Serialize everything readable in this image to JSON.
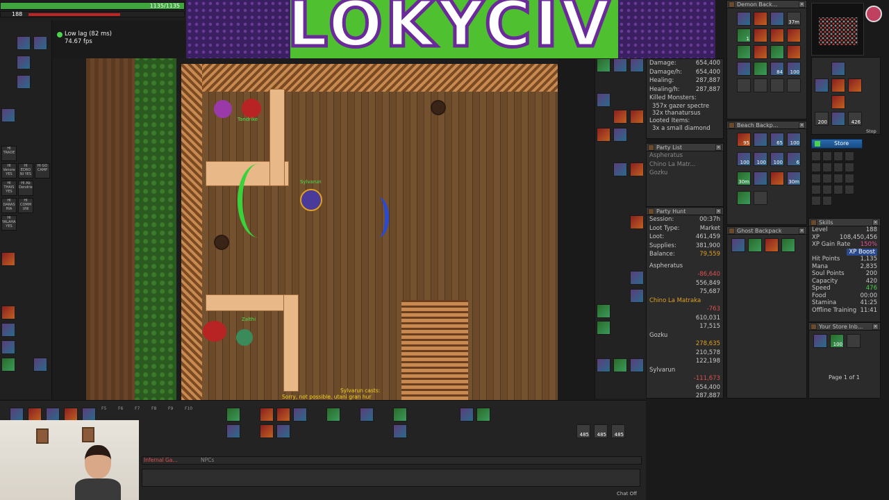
{
  "status": {
    "health_text": "1135/1135",
    "health_fraction": 1.0,
    "mana_value": "188",
    "mana_fraction": 0.5,
    "health_color": "#3fa63f",
    "mana_color": "#c02424"
  },
  "lag": {
    "label": "Low lag (82 ms)",
    "fps": "74.67 fps"
  },
  "stream_banner": {
    "text": "LOKYCIV",
    "bg_color": "#4fc030"
  },
  "map": {
    "char_names": [
      "Tandrike",
      "Sylvarun",
      "Zalthi"
    ],
    "cast_line1": "Sylvarun casts:",
    "cast_line2": "Sorry, not possible. utani gran hur"
  },
  "left_buttons": [
    "HI TRADE",
    "HI Venore YES",
    "HI EDRO NI YES",
    "HI GO CAMP",
    "HI THAIS YES",
    "HI Ab Dendriel",
    "HI DARAS HIA",
    "HI COMM UNI",
    "HI YALAHAR YES"
  ],
  "analytics": {
    "rows": [
      {
        "label": "Damage:",
        "value": "654,400"
      },
      {
        "label": "Damage/h:",
        "value": "654,400"
      },
      {
        "label": "Healing:",
        "value": "287,887"
      },
      {
        "label": "Healing/h:",
        "value": "287,887"
      }
    ],
    "killed_label": "Killed Monsters:",
    "killed": [
      "357x gazer spectre",
      "32x thanatursus"
    ],
    "looted_label": "Looted Items:",
    "looted": [
      "3x a small diamond"
    ]
  },
  "party_list": {
    "title": "Party List",
    "members": [
      "Aspheratus",
      "Chino La Matr...",
      "Gozku"
    ]
  },
  "party_hunt": {
    "title": "Party Hunt",
    "summary": [
      {
        "label": "Session:",
        "value": "00:37h"
      },
      {
        "label": "Loot Type:",
        "value": "Market"
      },
      {
        "label": "Loot:",
        "value": "461,459"
      },
      {
        "label": "Supplies:",
        "value": "381,900"
      },
      {
        "label": "Balance:",
        "value": "79,559"
      }
    ],
    "players": [
      {
        "name": "Aspheratus",
        "balance": "-86,640",
        "damage": "556,849",
        "healing": "75,687"
      },
      {
        "name": "Chino La Matraka",
        "balance": "-763",
        "damage": "610,031",
        "healing": "17,515"
      },
      {
        "name": "Gozku",
        "balance": "278,635",
        "damage": "210,578",
        "healing": "122,198"
      },
      {
        "name": "Sylvarun",
        "balance": "-111,673",
        "damage": "654,400",
        "healing": "287,887"
      }
    ]
  },
  "demon_backpack": {
    "title": "Demon Back...",
    "counts": [
      "37m",
      "1",
      "84",
      "100"
    ]
  },
  "beach_backpack": {
    "title": "Beach Backp...",
    "counts": [
      "95",
      "65",
      "100",
      "100",
      "100",
      "100",
      "6",
      "30m",
      "30m"
    ]
  },
  "ghost_backpack": {
    "title": "Ghost Backpack"
  },
  "store": {
    "label": "Store",
    "stop_label": "Stop",
    "cap_value": "200",
    "soul_value": "426"
  },
  "skills": {
    "title": "Skills",
    "rows": [
      {
        "label": "Level",
        "value": "188"
      },
      {
        "label": "XP",
        "value": "108,450,456"
      },
      {
        "label": "XP Gain Rate",
        "value": "150%"
      },
      {
        "label": "XP Boost",
        "value": ""
      },
      {
        "label": "Hit Points",
        "value": "1,135"
      },
      {
        "label": "Mana",
        "value": "2,835"
      },
      {
        "label": "Soul Points",
        "value": "200"
      },
      {
        "label": "Capacity",
        "value": "420"
      },
      {
        "label": "Speed",
        "value": "476"
      },
      {
        "label": "Food",
        "value": "00:00"
      },
      {
        "label": "Stamina",
        "value": "41:25"
      },
      {
        "label": "Offline Training",
        "value": "11:41"
      }
    ]
  },
  "store_inbox": {
    "title": "Your Store Inb...",
    "count": "100",
    "page": "Page 1 of 1"
  },
  "chat": {
    "tab_server": "Infernal Ga...",
    "tab_npcs": "NPCs",
    "chat_off": "Chat Off"
  },
  "hotkeys": {
    "labels": [
      "F5",
      "F6",
      "F7",
      "F8",
      "F9",
      "F10"
    ],
    "counts": [
      "485",
      "485",
      "485"
    ]
  }
}
